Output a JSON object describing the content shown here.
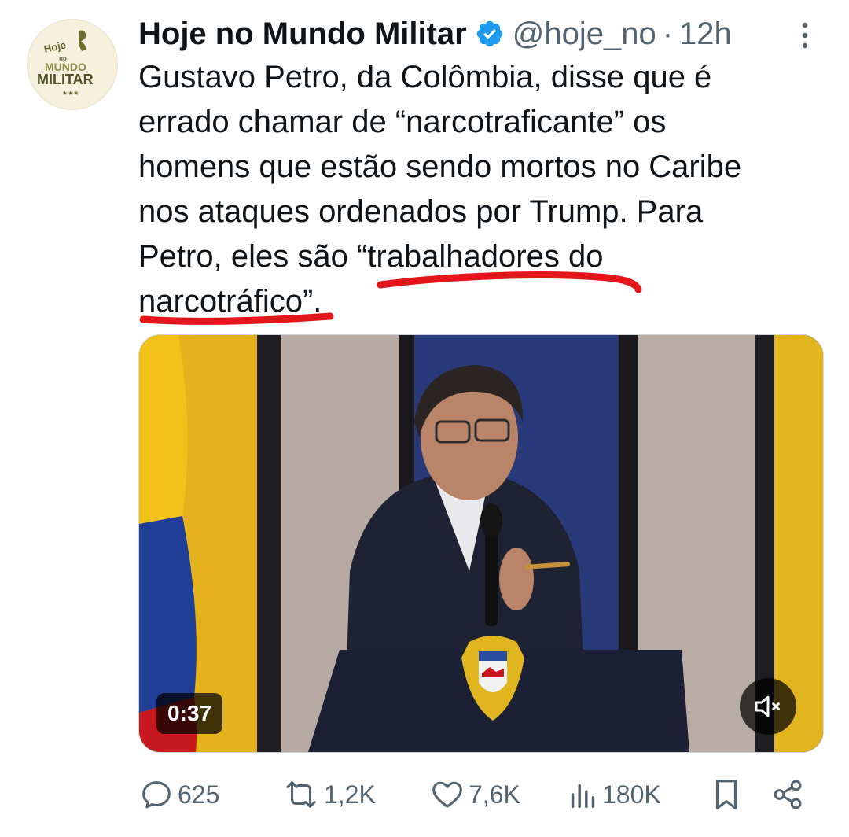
{
  "author": {
    "display_name": "Hoje no Mundo Militar",
    "handle": "@hoje_no",
    "separator": "·",
    "time": "12h",
    "verified_icon": "verified-badge-icon",
    "avatar_lines": [
      "Hoje",
      "no",
      "MUNDO",
      "MILITAR"
    ]
  },
  "tweet": {
    "lines": [
      "Gustavo Petro, da Colômbia, disse que é",
      "errado chamar de “narcotraficante” os",
      "homens que estão sendo mortos no Caribe",
      "nos ataques ordenados por Trump. Para",
      "Petro, eles são “trabalhadores do",
      "narcotráfico”."
    ]
  },
  "media": {
    "duration": "0:37",
    "mute_icon": "muted-speaker-icon"
  },
  "actions": {
    "replies": "625",
    "reposts": "1,2K",
    "likes": "7,6K",
    "views": "180K"
  },
  "colors": {
    "text_primary": "#0f1419",
    "text_secondary": "#536471",
    "verified_blue": "#1d9bf0",
    "annotation_red": "#e3161b"
  }
}
